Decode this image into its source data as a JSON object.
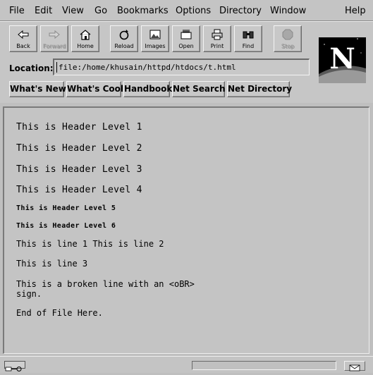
{
  "menu": {
    "items": [
      "File",
      "Edit",
      "View",
      "Go",
      "Bookmarks",
      "Options",
      "Directory",
      "Window"
    ],
    "help": "Help"
  },
  "toolbar": {
    "buttons": [
      {
        "label": "Back",
        "icon": "back-arrow-icon",
        "enabled": true
      },
      {
        "label": "Forward",
        "icon": "forward-arrow-icon",
        "enabled": false
      },
      {
        "label": "Home",
        "icon": "home-icon",
        "enabled": true
      },
      {
        "label": "Reload",
        "icon": "reload-icon",
        "enabled": true
      },
      {
        "label": "Images",
        "icon": "images-icon",
        "enabled": true
      },
      {
        "label": "Open",
        "icon": "open-icon",
        "enabled": true
      },
      {
        "label": "Print",
        "icon": "print-icon",
        "enabled": true
      },
      {
        "label": "Find",
        "icon": "find-icon",
        "enabled": true
      },
      {
        "label": "Stop",
        "icon": "stop-icon",
        "enabled": false
      }
    ]
  },
  "location": {
    "label": "Location:",
    "value": "file:/home/khusain/httpd/htdocs/t.html"
  },
  "directory_buttons": [
    "What's New",
    "What's Cool",
    "Handbook",
    "Net Search",
    "Net Directory"
  ],
  "logo": {
    "letter": "N"
  },
  "content": {
    "h1": "This is Header Level 1",
    "h2": "This is Header Level 2",
    "h3": "This is Header Level 3",
    "h4": "This is Header Level 4",
    "h5": "This is Header Level 5",
    "h6": "This is Header Level 6",
    "line12": "This is line 1 This is line 2",
    "line3": "This is line 3",
    "broken_line_1": "This is a broken line with an <oBR>",
    "broken_line_2": "sign.",
    "end": "End of File Here."
  },
  "status": {
    "progress": 0
  }
}
